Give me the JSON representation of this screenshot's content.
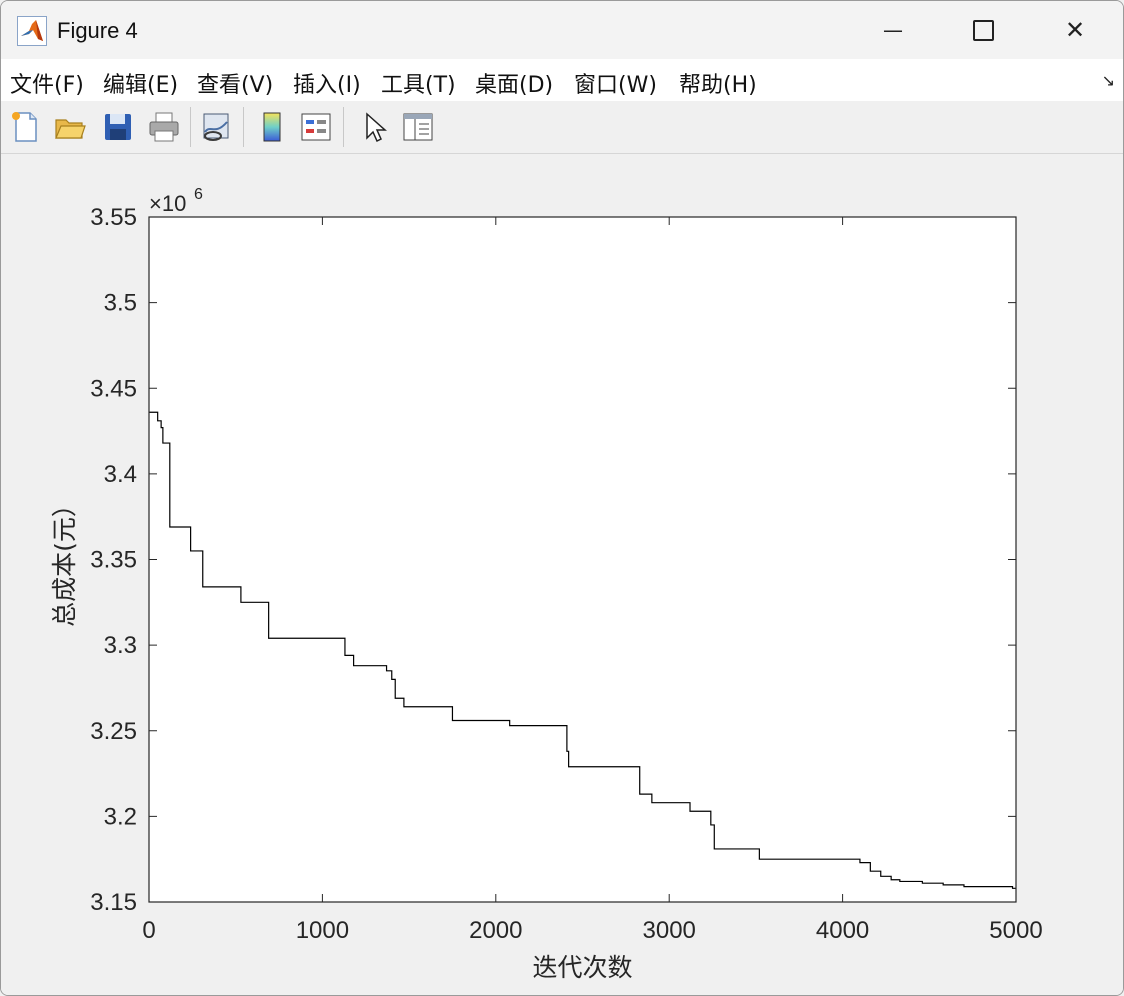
{
  "window": {
    "title": "Figure 4",
    "minimize_glyph": "—",
    "close_glyph": "✕"
  },
  "menu": {
    "items": [
      "文件(F)",
      "编辑(E)",
      "查看(V)",
      "插入(I)",
      "工具(T)",
      "桌面(D)",
      "窗口(W)",
      "帮助(H)"
    ],
    "overflow_glyph": "↘"
  },
  "toolbar": {
    "icons": [
      "new-figure-icon",
      "open-file-icon",
      "save-icon",
      "print-icon",
      "link-plot-icon",
      "colorbar-icon",
      "legend-icon",
      "pointer-icon",
      "property-inspector-icon"
    ]
  },
  "chart_data": {
    "type": "line",
    "title": "",
    "xlabel": "迭代次数",
    "ylabel": "总成本(元）",
    "exponent_label": "×10",
    "exponent_power": "6",
    "xlim": [
      0,
      5000
    ],
    "ylim": [
      3.15,
      3.55
    ],
    "xticks": [
      0,
      1000,
      2000,
      3000,
      4000,
      5000
    ],
    "xtick_labels": [
      "0",
      "1000",
      "2000",
      "3000",
      "4000",
      "5000"
    ],
    "yticks": [
      3.15,
      3.2,
      3.25,
      3.3,
      3.35,
      3.4,
      3.45,
      3.5,
      3.55
    ],
    "ytick_labels": [
      "3.15",
      "3.2",
      "3.25",
      "3.3",
      "3.35",
      "3.4",
      "3.45",
      "3.5",
      "3.55"
    ],
    "grid": false,
    "line_color": "#000000",
    "series": [
      {
        "step": true,
        "x": [
          0,
          50,
          70,
          80,
          120,
          240,
          310,
          530,
          690,
          1130,
          1180,
          1370,
          1400,
          1420,
          1470,
          1750,
          2080,
          2410,
          2420,
          2830,
          2900,
          3120,
          3240,
          3260,
          3520,
          4100,
          4160,
          4220,
          4280,
          4330,
          4460,
          4580,
          4610,
          4700,
          4960,
          4980,
          5000
        ],
        "y": [
          3.436,
          3.431,
          3.427,
          3.418,
          3.369,
          3.355,
          3.334,
          3.325,
          3.304,
          3.294,
          3.288,
          3.285,
          3.28,
          3.269,
          3.264,
          3.256,
          3.253,
          3.238,
          3.229,
          3.213,
          3.208,
          3.203,
          3.195,
          3.181,
          3.175,
          3.173,
          3.168,
          3.165,
          3.163,
          3.162,
          3.161,
          3.16,
          3.16,
          3.159,
          3.159,
          3.158,
          3.158
        ]
      }
    ]
  }
}
